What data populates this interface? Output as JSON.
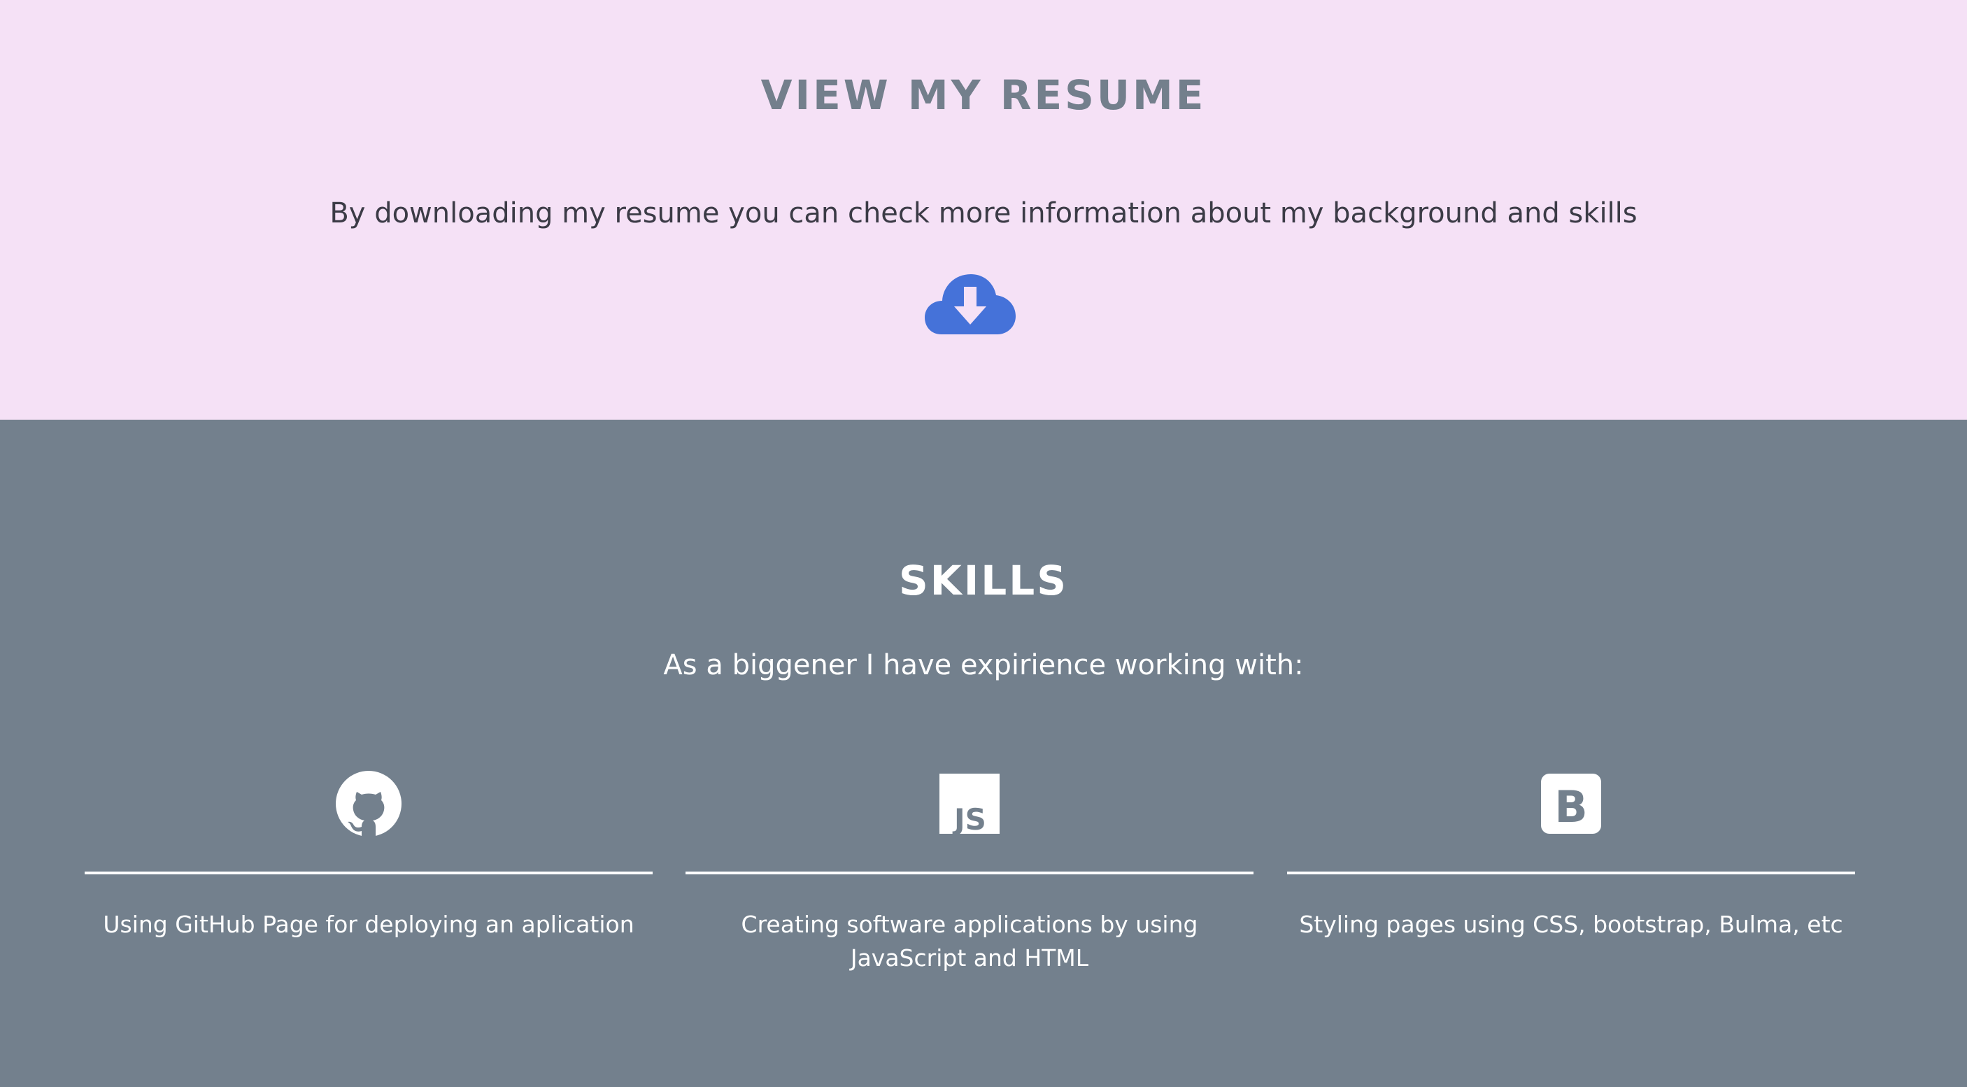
{
  "resume": {
    "title": "VIEW MY RESUME",
    "description": "By downloading my resume you can check more information about my background and skills",
    "download_icon": "cloud-download-icon",
    "background": "#f5e1f6",
    "title_color": "#737f8c",
    "icon_color": "#4572d9"
  },
  "skills": {
    "title": "SKILLS",
    "subtitle": "As a biggener I have expirience working with:",
    "background": "#73808d",
    "items": [
      {
        "icon": "github-icon",
        "text": "Using GitHub Page for deploying an aplication"
      },
      {
        "icon": "javascript-icon",
        "text": "Creating software applications by using JavaScript and HTML"
      },
      {
        "icon": "bootstrap-icon",
        "text": "Styling pages using CSS, bootstrap, Bulma, etc"
      }
    ]
  }
}
